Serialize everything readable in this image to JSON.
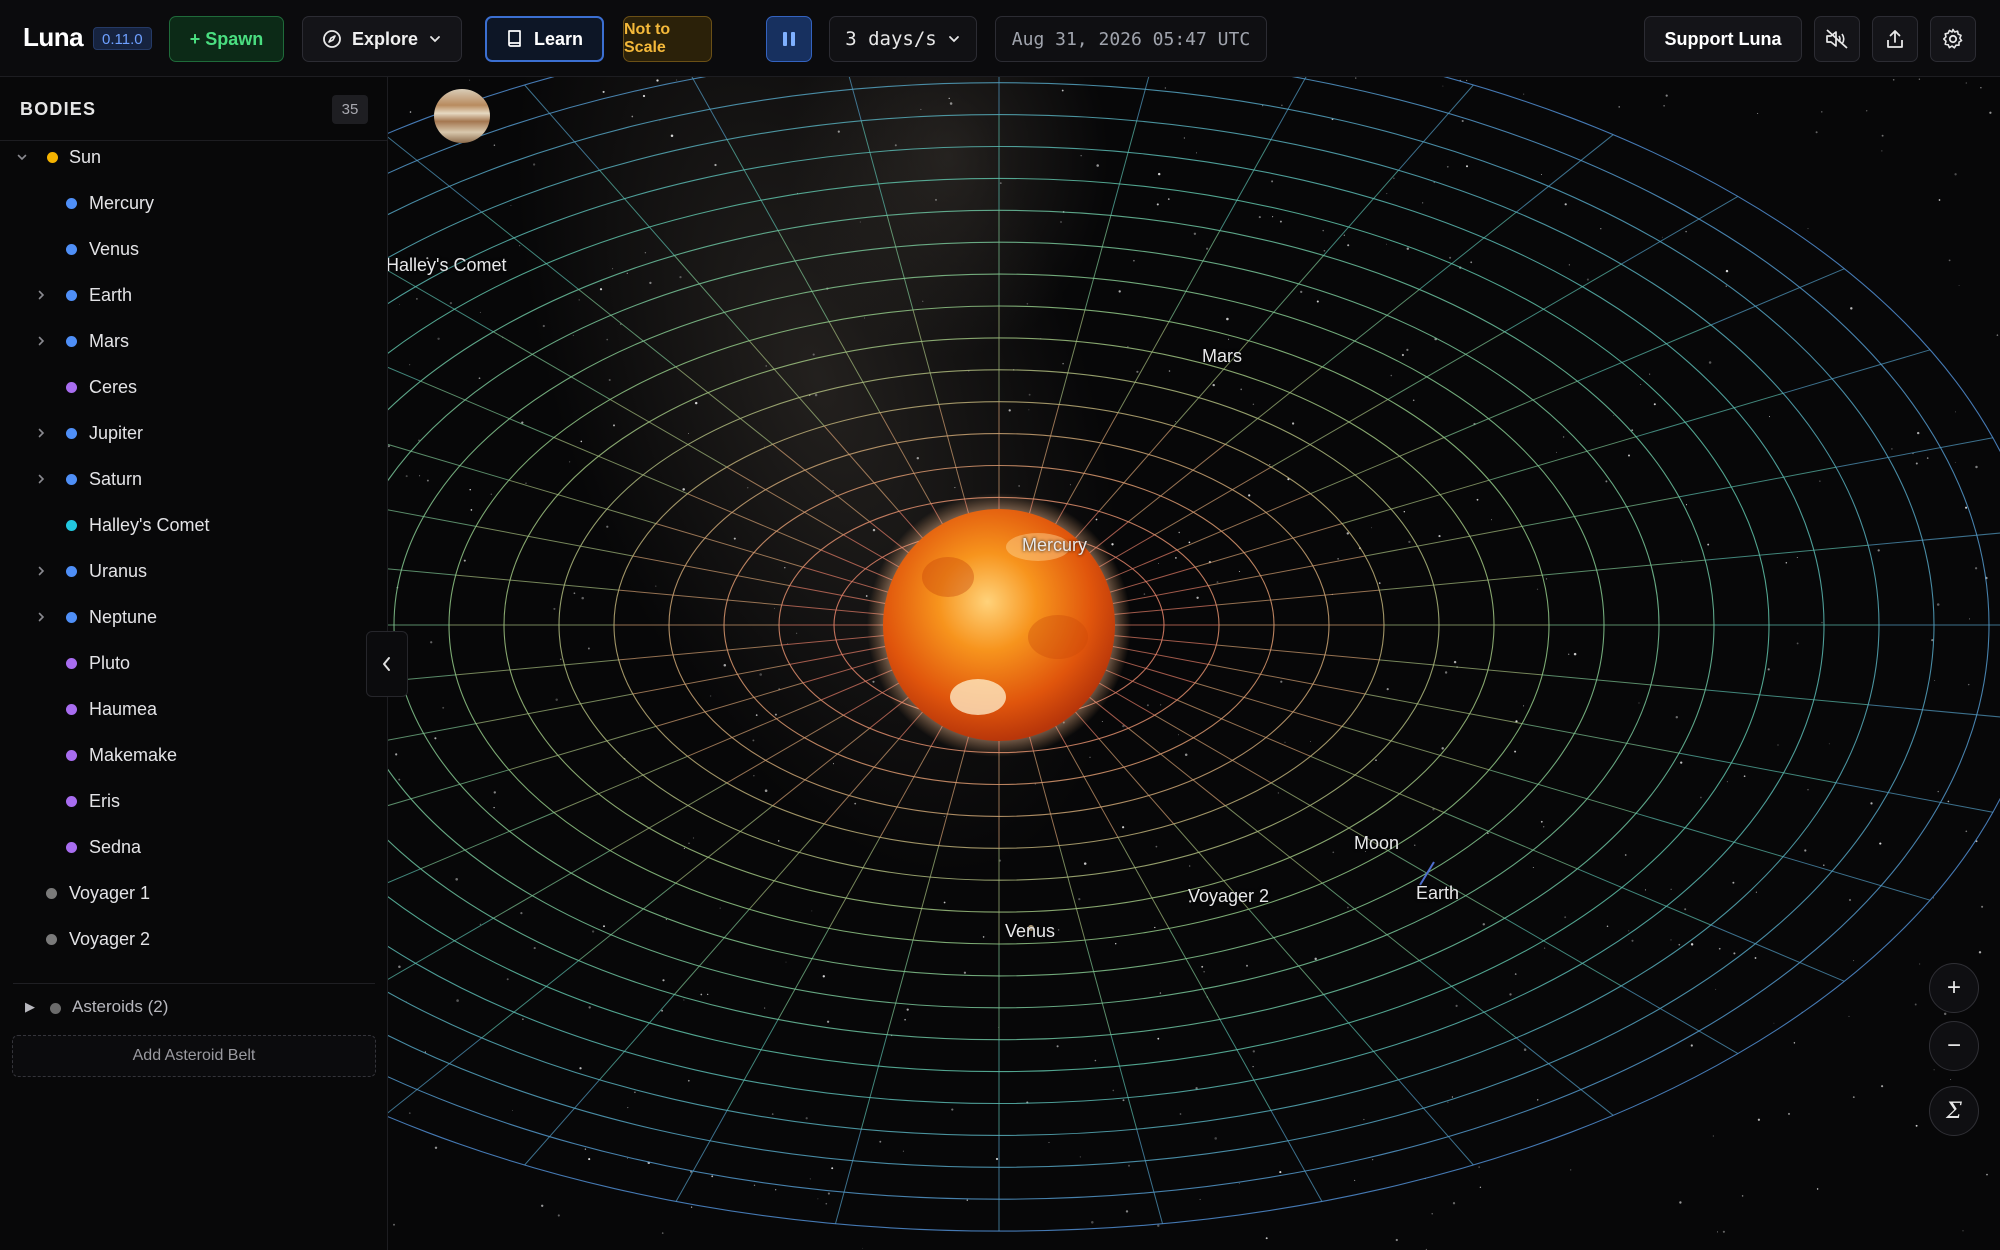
{
  "app": {
    "name": "Luna",
    "version": "0.11.0"
  },
  "toolbar": {
    "spawn_label": "+ Spawn",
    "explore_label": "Explore",
    "learn_label": "Learn",
    "scale_label": "Not to Scale",
    "speed_label": "3 days/s",
    "datetime": "Aug 31, 2026 05:47 UTC",
    "support_label": "Support Luna",
    "icons": {
      "explore": "compass-icon",
      "learn": "book-icon",
      "pause": "pause-icon",
      "speed": "chevron-down-icon",
      "mute": "speaker-muted-icon",
      "share": "share-icon",
      "settings": "gear-icon"
    }
  },
  "sidebar": {
    "title": "BODIES",
    "count": "35",
    "bodies": [
      {
        "name": "Sun",
        "color": "#f5b300",
        "level": 0,
        "expandable": true,
        "expanded": true
      },
      {
        "name": "Mercury",
        "color": "#4f8ff7",
        "level": 1,
        "expandable": false
      },
      {
        "name": "Venus",
        "color": "#4f8ff7",
        "level": 1,
        "expandable": false
      },
      {
        "name": "Earth",
        "color": "#4f8ff7",
        "level": 1,
        "expandable": true,
        "expanded": false
      },
      {
        "name": "Mars",
        "color": "#4f8ff7",
        "level": 1,
        "expandable": true,
        "expanded": false
      },
      {
        "name": "Ceres",
        "color": "#a86df0",
        "level": 1,
        "expandable": false
      },
      {
        "name": "Jupiter",
        "color": "#4f8ff7",
        "level": 1,
        "expandable": true,
        "expanded": false
      },
      {
        "name": "Saturn",
        "color": "#4f8ff7",
        "level": 1,
        "expandable": true,
        "expanded": false
      },
      {
        "name": "Halley's Comet",
        "color": "#22c7df",
        "level": 1,
        "expandable": false
      },
      {
        "name": "Uranus",
        "color": "#4f8ff7",
        "level": 1,
        "expandable": true,
        "expanded": false
      },
      {
        "name": "Neptune",
        "color": "#4f8ff7",
        "level": 1,
        "expandable": true,
        "expanded": false
      },
      {
        "name": "Pluto",
        "color": "#a86df0",
        "level": 1,
        "expandable": false
      },
      {
        "name": "Haumea",
        "color": "#a86df0",
        "level": 1,
        "expandable": false
      },
      {
        "name": "Makemake",
        "color": "#a86df0",
        "level": 1,
        "expandable": false
      },
      {
        "name": "Eris",
        "color": "#a86df0",
        "level": 1,
        "expandable": false
      },
      {
        "name": "Sedna",
        "color": "#a86df0",
        "level": 1,
        "expandable": false
      },
      {
        "name": "Voyager 1",
        "color": "#7a7a7a",
        "level": 0.5,
        "expandable": false
      },
      {
        "name": "Voyager 2",
        "color": "#7a7a7a",
        "level": 0.5,
        "expandable": false
      }
    ],
    "asteroids_label": "Asteroids (2)",
    "add_belt_label": "Add Asteroid Belt"
  },
  "viewport": {
    "labels": {
      "halley": "Halley's Comet",
      "mars": "Mars",
      "mercury": "Mercury",
      "moon": "Moon",
      "earth": "Earth",
      "voyager2": "Voyager 2",
      "venus": "Venus"
    },
    "controls": {
      "zoom_in": "+",
      "zoom_out": "−",
      "sigma": "Σ"
    }
  }
}
